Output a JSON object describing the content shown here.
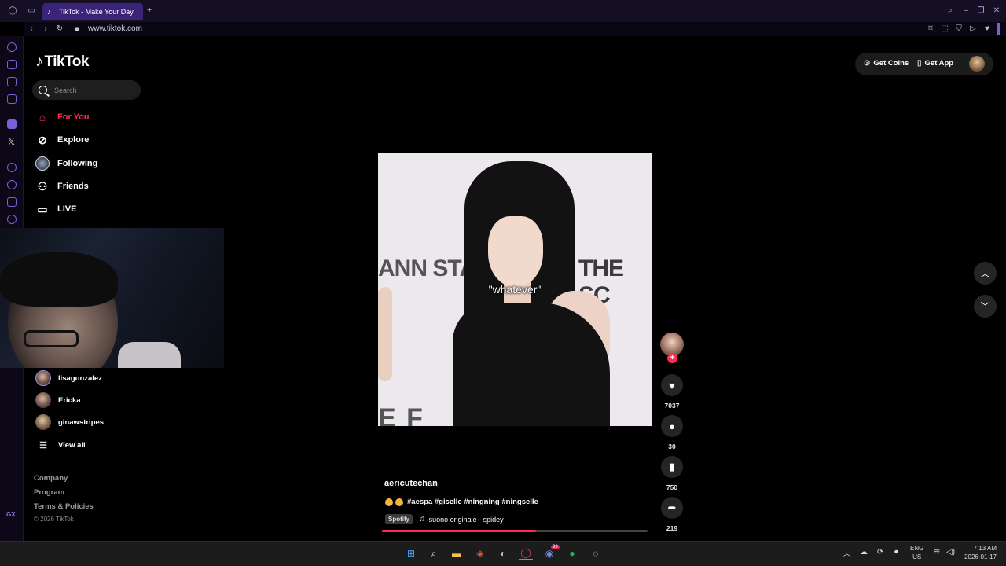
{
  "browser": {
    "tab_title": "TikTok - Make Your Day",
    "url": "www.tiktok.com",
    "gx_label": "GX"
  },
  "sidebar": {
    "brand": "TikTok",
    "search_placeholder": "Search",
    "nav": [
      {
        "label": "For You",
        "icon": "home-icon",
        "active": true
      },
      {
        "label": "Explore",
        "icon": "compass-icon"
      },
      {
        "label": "Following",
        "icon": "following-avatar-icon"
      },
      {
        "label": "Friends",
        "icon": "friends-icon"
      },
      {
        "label": "LIVE",
        "icon": "live-tv-icon"
      }
    ],
    "following_accounts": [
      {
        "name": "lisagonzalez"
      },
      {
        "name": "Ericka"
      },
      {
        "name": "ginawstripes"
      }
    ],
    "view_all": "View all",
    "footer": [
      "Company",
      "Program",
      "Terms & Policies"
    ],
    "copyright": "© 2026 TikTok"
  },
  "header": {
    "get_coins": "Get Coins",
    "get_app": "Get App"
  },
  "video": {
    "caption_overlay": "\"whatever\"",
    "banner_left": "ANN STA",
    "banner_right": "THE SC",
    "banner_bottom": "E F",
    "author": "aericutechan",
    "description": "#aespa #giselle #ningning #ningselle",
    "music_badge": "Spotify",
    "music": "suono originale - spidey",
    "progress": 0.58
  },
  "actions": {
    "likes": "7037",
    "comments": "30",
    "saves": "750",
    "shares": "219"
  },
  "taskbar": {
    "lang_top": "ENG",
    "lang_bottom": "US",
    "time": "7:13 AM",
    "date": "2026-01-17",
    "discord_badge": "99"
  },
  "colors": {
    "accent": "#fe2c55",
    "opera_purple": "#3b2378"
  }
}
